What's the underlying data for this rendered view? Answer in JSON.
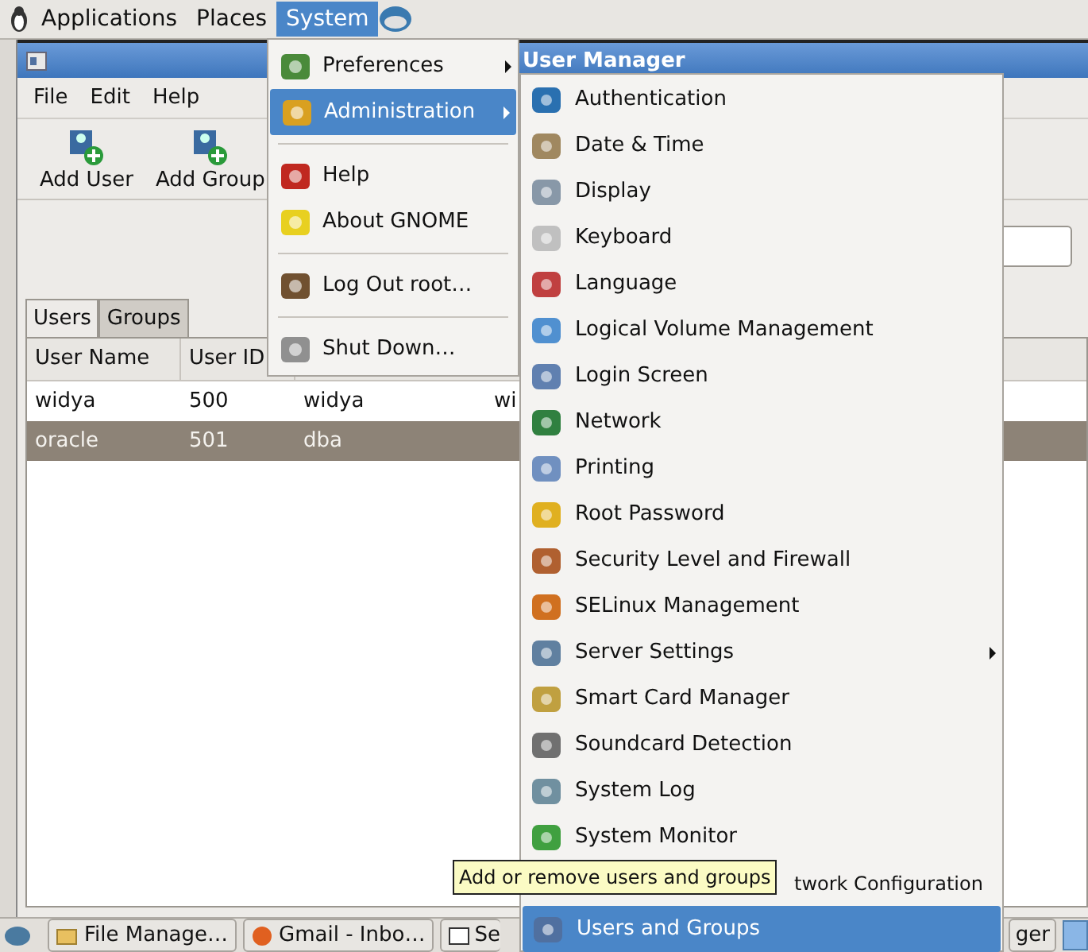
{
  "top_panel": {
    "menus": [
      {
        "label": "Applications",
        "selected": false
      },
      {
        "label": "Places",
        "selected": false
      },
      {
        "label": "System",
        "selected": true
      }
    ]
  },
  "window": {
    "title": "User Manager",
    "menu": [
      "File",
      "Edit",
      "Help"
    ],
    "toolbar": [
      "Add User",
      "Add Group"
    ]
  },
  "tabs": [
    {
      "label": "Users",
      "selected": true
    },
    {
      "label": "Groups",
      "selected": false
    }
  ],
  "table": {
    "columns": [
      "User Name",
      "User ID"
    ],
    "rows": [
      {
        "cells": [
          "widya",
          "500",
          "widya",
          "wi"
        ],
        "selected": false
      },
      {
        "cells": [
          "oracle",
          "501",
          "dba"
        ],
        "selected": true
      }
    ]
  },
  "system_menu": {
    "items": [
      {
        "kind": "submenu",
        "label": "Preferences",
        "selected": false
      },
      {
        "kind": "submenu",
        "label": "Administration",
        "selected": true
      },
      {
        "kind": "separator"
      },
      {
        "kind": "item",
        "label": "Help",
        "selected": false
      },
      {
        "kind": "item",
        "label": "About GNOME",
        "selected": false
      },
      {
        "kind": "separator"
      },
      {
        "kind": "item",
        "label": "Log Out root…",
        "selected": false
      },
      {
        "kind": "separator"
      },
      {
        "kind": "item",
        "label": "Shut Down…",
        "selected": false
      }
    ]
  },
  "administration_menu": {
    "items": [
      {
        "kind": "item",
        "label": "Authentication",
        "selected": false
      },
      {
        "kind": "item",
        "label": "Date & Time",
        "selected": false
      },
      {
        "kind": "item",
        "label": "Display",
        "selected": false
      },
      {
        "kind": "item",
        "label": "Keyboard",
        "selected": false
      },
      {
        "kind": "item",
        "label": "Language",
        "selected": false
      },
      {
        "kind": "item",
        "label": "Logical Volume Management",
        "selected": false
      },
      {
        "kind": "item",
        "label": "Login Screen",
        "selected": false
      },
      {
        "kind": "item",
        "label": "Network",
        "selected": false
      },
      {
        "kind": "item",
        "label": "Printing",
        "selected": false
      },
      {
        "kind": "item",
        "label": "Root Password",
        "selected": false
      },
      {
        "kind": "item",
        "label": "Security Level and Firewall",
        "selected": false
      },
      {
        "kind": "item",
        "label": "SELinux Management",
        "selected": false
      },
      {
        "kind": "submenu",
        "label": "Server Settings",
        "selected": false
      },
      {
        "kind": "item",
        "label": "Smart Card Manager",
        "selected": false
      },
      {
        "kind": "item",
        "label": "Soundcard Detection",
        "selected": false
      },
      {
        "kind": "item",
        "label": "System Log",
        "selected": false
      },
      {
        "kind": "item",
        "label": "System Monitor",
        "selected": false
      },
      {
        "kind": "covered",
        "label": "twork Configuration",
        "selected": false
      },
      {
        "kind": "item",
        "label": "Users and Groups",
        "selected": true
      }
    ]
  },
  "tooltip": "Add or remove users and groups",
  "taskbar": {
    "buttons": [
      "File Manage…",
      "Gmail - Inbo…",
      "Se",
      "ger"
    ]
  }
}
